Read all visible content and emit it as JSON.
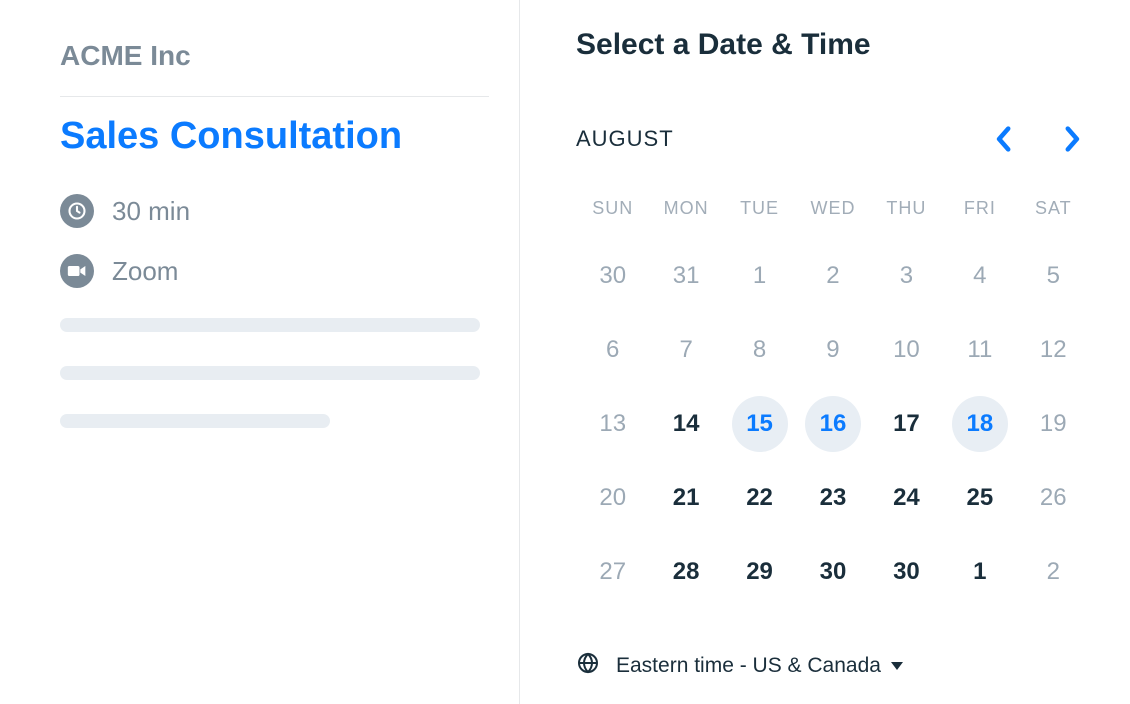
{
  "company": "ACME Inc",
  "event_title": "Sales Consultation",
  "duration_label": "30 min",
  "location_label": "Zoom",
  "heading": "Select a Date & Time",
  "month": "AUGUST",
  "timezone": "Eastern time - US & Canada",
  "dow": [
    "SUN",
    "MON",
    "TUE",
    "WED",
    "THU",
    "FRI",
    "SAT"
  ],
  "days": [
    {
      "n": "30",
      "state": "dim"
    },
    {
      "n": "31",
      "state": "dim"
    },
    {
      "n": "1",
      "state": "dim"
    },
    {
      "n": "2",
      "state": "dim"
    },
    {
      "n": "3",
      "state": "dim"
    },
    {
      "n": "4",
      "state": "dim"
    },
    {
      "n": "5",
      "state": "dim"
    },
    {
      "n": "6",
      "state": "dim"
    },
    {
      "n": "7",
      "state": "dim"
    },
    {
      "n": "8",
      "state": "dim"
    },
    {
      "n": "9",
      "state": "dim"
    },
    {
      "n": "10",
      "state": "dim"
    },
    {
      "n": "11",
      "state": "dim"
    },
    {
      "n": "12",
      "state": "dim"
    },
    {
      "n": "13",
      "state": "dim"
    },
    {
      "n": "14",
      "state": "plain"
    },
    {
      "n": "15",
      "state": "avail"
    },
    {
      "n": "16",
      "state": "avail"
    },
    {
      "n": "17",
      "state": "plain"
    },
    {
      "n": "18",
      "state": "avail"
    },
    {
      "n": "19",
      "state": "dim"
    },
    {
      "n": "20",
      "state": "dim"
    },
    {
      "n": "21",
      "state": "plain"
    },
    {
      "n": "22",
      "state": "plain"
    },
    {
      "n": "23",
      "state": "plain"
    },
    {
      "n": "24",
      "state": "plain"
    },
    {
      "n": "25",
      "state": "plain"
    },
    {
      "n": "26",
      "state": "dim"
    },
    {
      "n": "27",
      "state": "dim"
    },
    {
      "n": "28",
      "state": "plain"
    },
    {
      "n": "29",
      "state": "plain"
    },
    {
      "n": "30",
      "state": "plain"
    },
    {
      "n": "30",
      "state": "plain"
    },
    {
      "n": "1",
      "state": "plain"
    },
    {
      "n": "2",
      "state": "dim"
    }
  ]
}
